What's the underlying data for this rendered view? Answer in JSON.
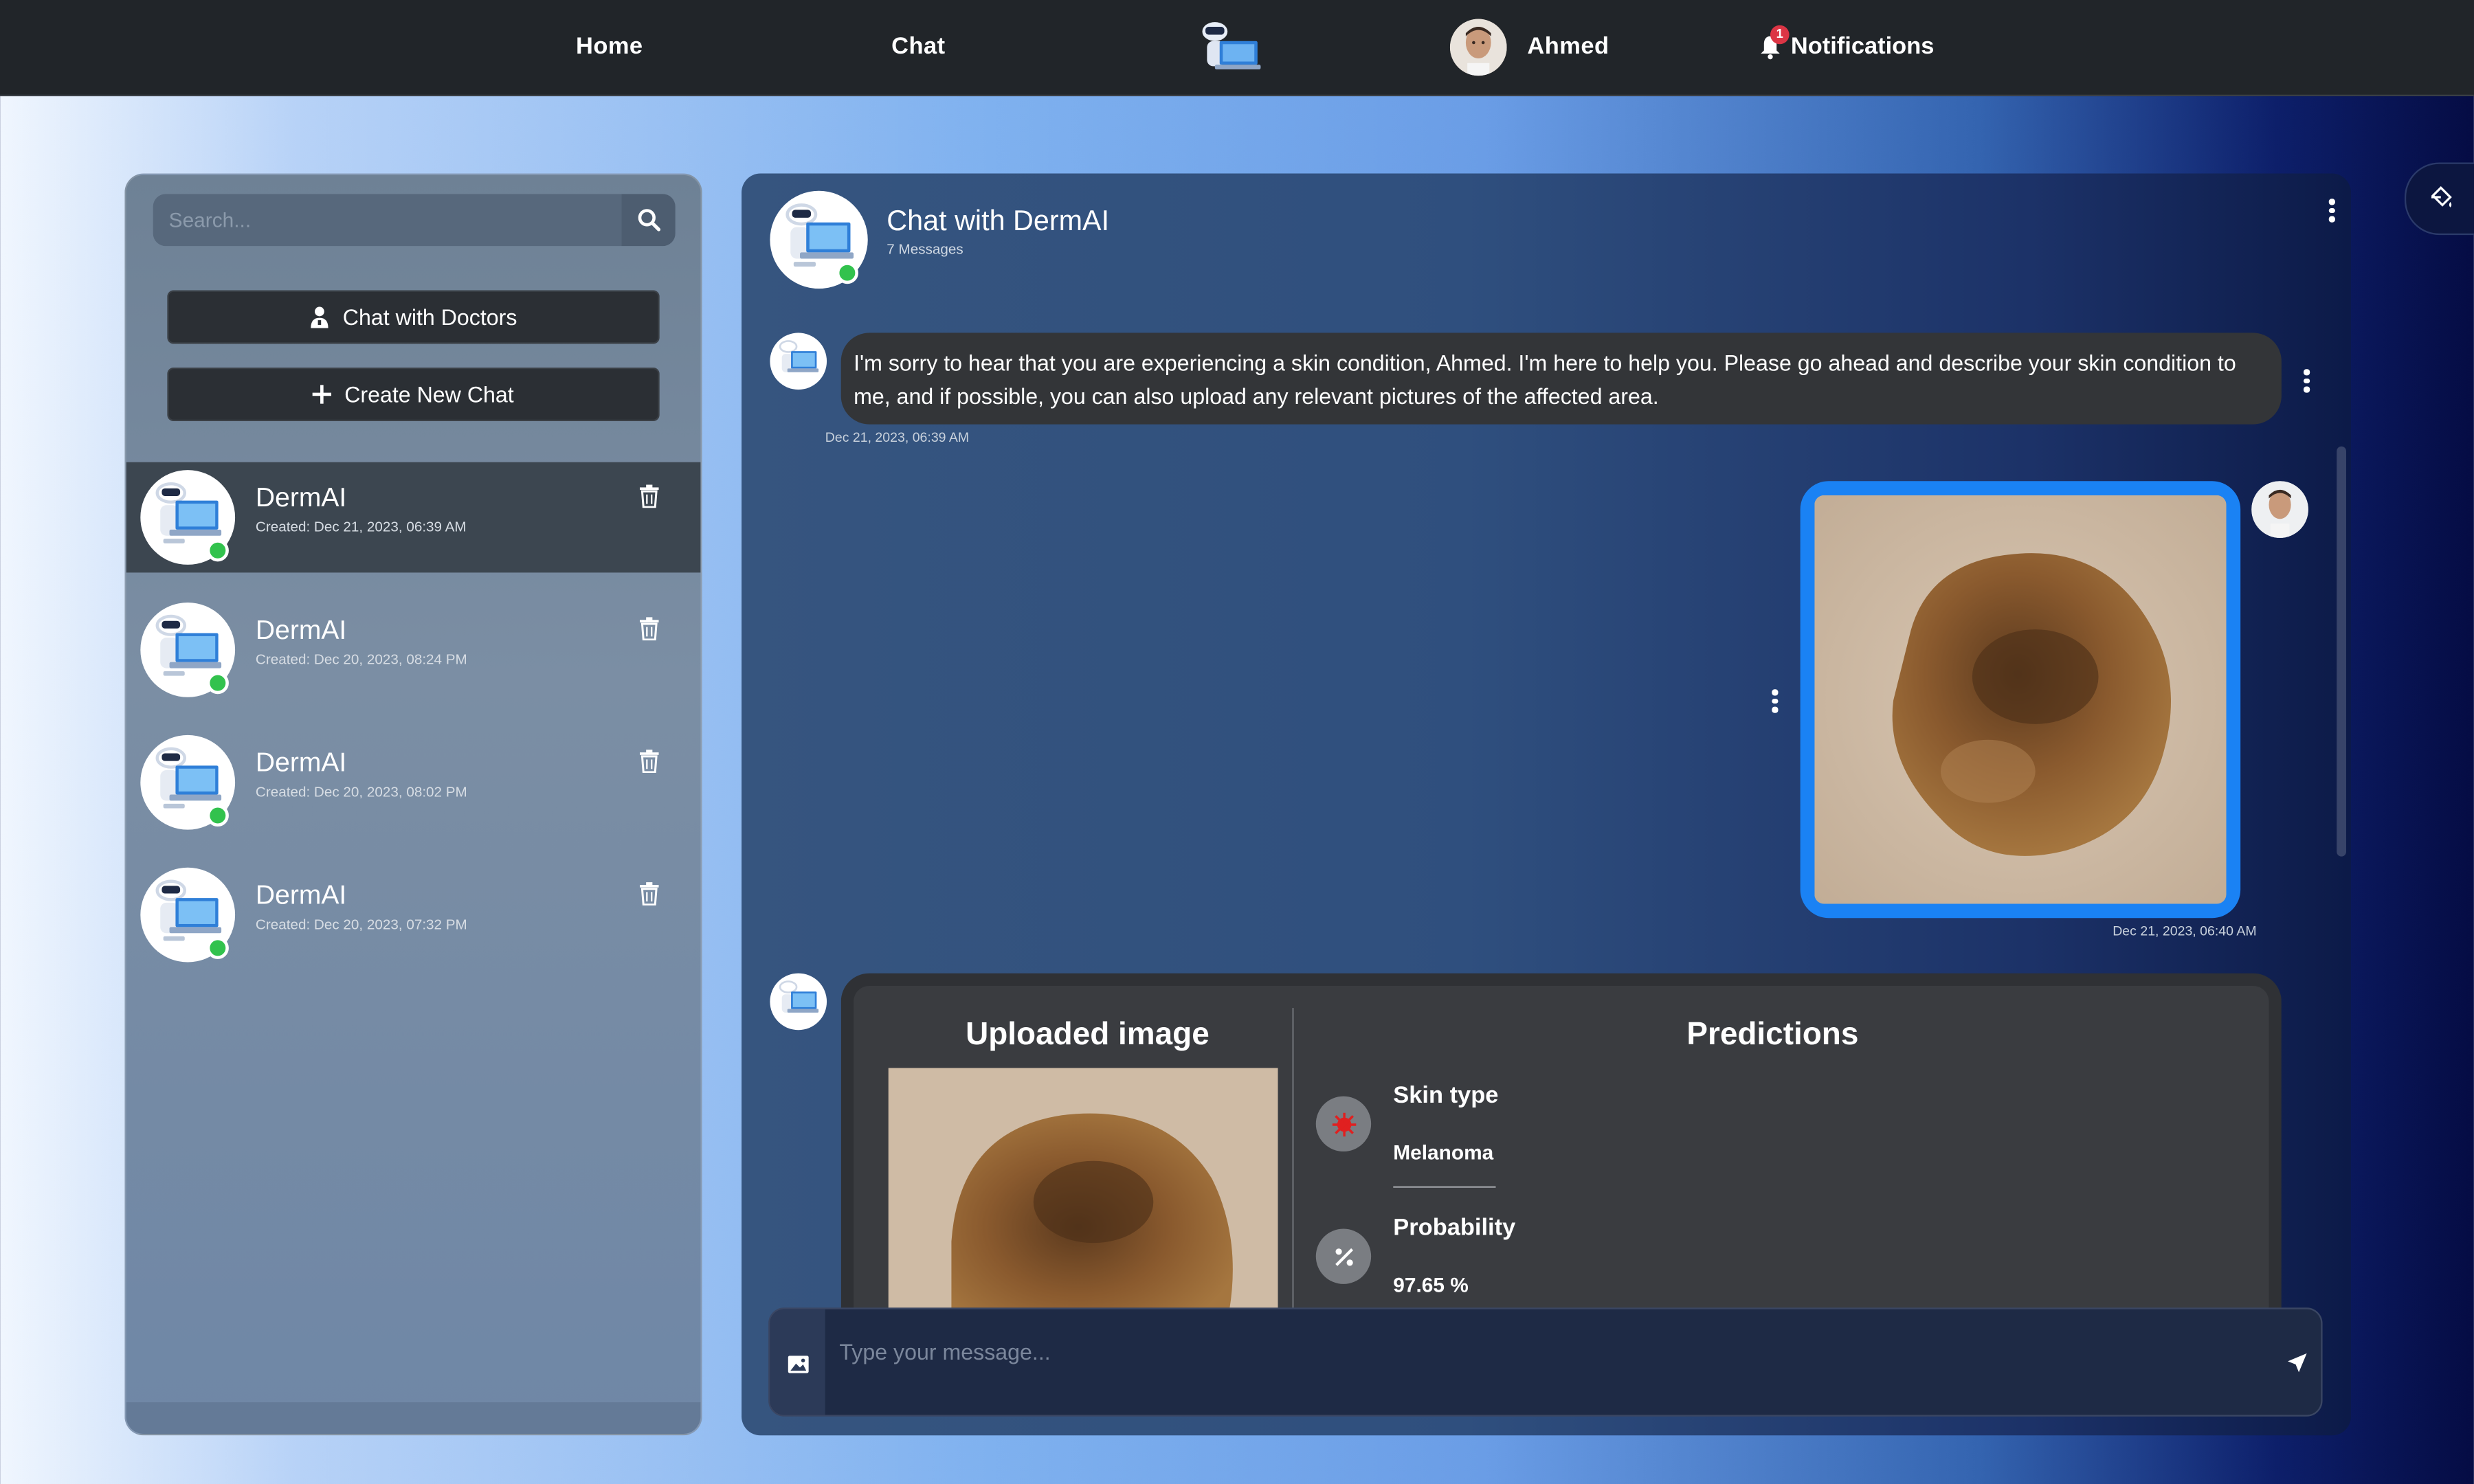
{
  "topbar": {
    "home": "Home",
    "chat": "Chat",
    "user_name": "Ahmed",
    "notifications_label": "Notifications",
    "notifications_count": "1"
  },
  "sidebar": {
    "search_placeholder": "Search...",
    "chat_with_doctors": "Chat with Doctors",
    "create_new_chat": "Create New Chat",
    "chats": [
      {
        "name": "DermAI",
        "created": "Created: Dec 21, 2023, 06:39 AM",
        "active": true
      },
      {
        "name": "DermAI",
        "created": "Created: Dec 20, 2023, 08:24 PM",
        "active": false
      },
      {
        "name": "DermAI",
        "created": "Created: Dec 20, 2023, 08:02 PM",
        "active": false
      },
      {
        "name": "DermAI",
        "created": "Created: Dec 20, 2023, 07:32 PM",
        "active": false
      }
    ]
  },
  "chat": {
    "title": "Chat with DermAI",
    "subtitle": "7 Messages",
    "messages": [
      {
        "text": "I'm sorry to hear that you are experiencing a skin condition, Ahmed. I'm here to help you. Please go ahead and describe your skin condition to me, and if possible, you can also upload any relevant pictures of the affected area.",
        "time": "Dec 21, 2023, 06:39 AM"
      },
      {
        "time": "Dec 21, 2023, 06:40 AM"
      }
    ],
    "prediction": {
      "uploaded_heading": "Uploaded image",
      "predictions_heading": "Predictions",
      "skin_type_label": "Skin type",
      "skin_type_value": "Melanoma",
      "probability_label": "Probability",
      "probability_value": "97.65 %"
    },
    "input_placeholder": "Type your message..."
  },
  "colors": {
    "topbar": "#212529",
    "online": "#32c24d",
    "image_border": "#1a82f4",
    "badge": "#dc3545"
  }
}
